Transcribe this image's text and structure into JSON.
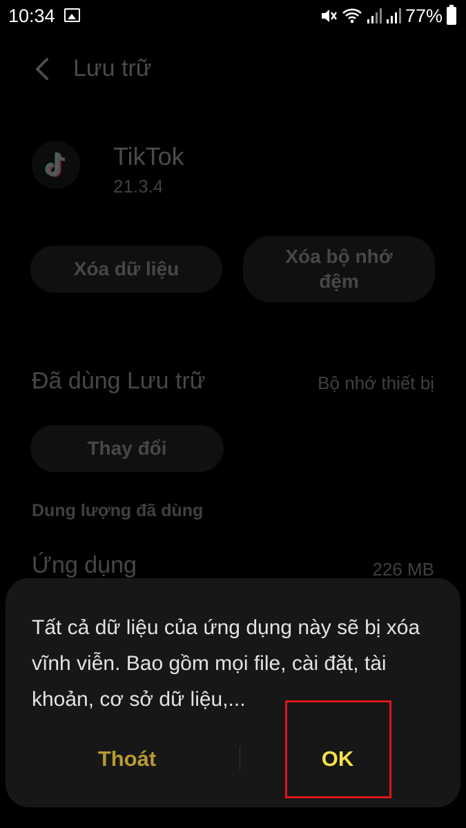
{
  "status_bar": {
    "time": "10:34",
    "battery_percent": "77%",
    "icons": [
      "gallery-icon",
      "mute-icon",
      "wifi-icon",
      "signal-icon",
      "signal-icon",
      "battery-icon"
    ]
  },
  "header": {
    "title": "Lưu trữ",
    "back_icon": "back-arrow-icon"
  },
  "app": {
    "name": "TikTok",
    "version": "21.3.4",
    "icon": "tiktok-logo-icon"
  },
  "actions": {
    "clear_data": "Xóa dữ liệu",
    "clear_cache": "Xóa bộ nhớ đệm"
  },
  "storage": {
    "label": "Đã dùng Lưu trữ",
    "value": "Bộ nhớ thiết bị",
    "change_button": "Thay đổi"
  },
  "usage": {
    "section_title": "Dung lượng đã dùng",
    "rows": [
      {
        "label": "Ứng dụng",
        "value": "226 MB"
      }
    ]
  },
  "dialog": {
    "message": "Tất cả dữ liệu của ứng dụng này sẽ bị xóa vĩnh viễn. Bao gồm mọi file, cài đặt, tài khoản, cơ sở dữ liệu,...",
    "cancel_label": "Thoát",
    "ok_label": "OK"
  },
  "colors": {
    "background": "#000000",
    "dialog_background": "#171717",
    "cancel_text": "#b79a32",
    "ok_text": "#f5e04c",
    "highlight": "#e3141c"
  }
}
